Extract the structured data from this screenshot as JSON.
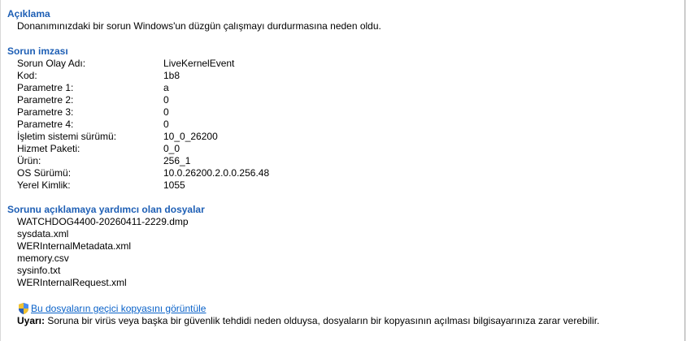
{
  "description": {
    "heading": "Açıklama",
    "text": "Donanımınızdaki bir sorun Windows'un düzgün çalışmayı durdurmasına neden oldu."
  },
  "signature": {
    "heading": "Sorun imzası",
    "rows": [
      {
        "label": "Sorun Olay Adı:",
        "value": "LiveKernelEvent"
      },
      {
        "label": "Kod:",
        "value": "1b8"
      },
      {
        "label": "Parametre 1:",
        "value": "a"
      },
      {
        "label": "Parametre 2:",
        "value": "0"
      },
      {
        "label": "Parametre 3:",
        "value": "0"
      },
      {
        "label": "Parametre 4:",
        "value": "0"
      },
      {
        "label": "İşletim sistemi sürümü:",
        "value": "10_0_26200"
      },
      {
        "label": "Hizmet Paketi:",
        "value": "0_0"
      },
      {
        "label": "Ürün:",
        "value": "256_1"
      },
      {
        "label": "OS Sürümü:",
        "value": "10.0.26200.2.0.0.256.48"
      },
      {
        "label": "Yerel Kimlik:",
        "value": "1055"
      }
    ]
  },
  "files": {
    "heading": "Sorunu açıklamaya yardımcı olan dosyalar",
    "items": [
      "WATCHDOG4400-20260411-2229.dmp",
      "sysdata.xml",
      "WERInternalMetadata.xml",
      "memory.csv",
      "sysinfo.txt",
      "WERInternalRequest.xml"
    ]
  },
  "temp_copy_link": {
    "icon": "uac-shield-icon",
    "label": "Bu dosyaların geçici kopyasını görüntüle"
  },
  "warning": {
    "prefix": "Uyarı:",
    "text": " Soruna bir virüs veya başka bir güvenlik tehdidi neden olduysa, dosyaların bir kopyasının açılması bilgisayarınıza zarar verebilir."
  },
  "colors": {
    "heading": "#1e5fb5",
    "link": "#0a62c9"
  }
}
